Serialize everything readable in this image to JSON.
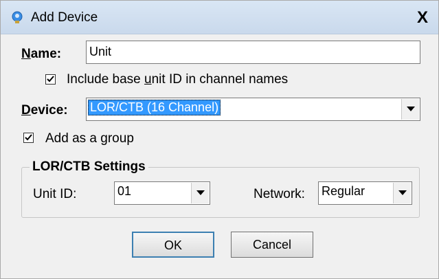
{
  "window": {
    "title": "Add Device",
    "close_glyph": "X"
  },
  "name_field": {
    "label_u": "N",
    "label_rest": "ame:",
    "value": "Unit"
  },
  "include_id_checkbox": {
    "checked": true,
    "label_a": "Include base ",
    "label_u": "u",
    "label_b": "nit ID in channel names"
  },
  "device_field": {
    "label_u": "D",
    "label_rest": "evice:",
    "selected": "LOR/CTB (16 Channel)"
  },
  "group_checkbox": {
    "checked": true,
    "label_a": "Add as a ",
    "label_u": "g",
    "label_b": "roup"
  },
  "settings": {
    "title": "LOR/CTB Settings",
    "unit_id_label": "Unit ID:",
    "unit_id_value": "01",
    "network_label": "Network:",
    "network_value": "Regular"
  },
  "buttons": {
    "ok": "OK",
    "cancel": "Cancel"
  },
  "colors": {
    "selection": "#3399ff",
    "titlebar": "#d9e6f4"
  },
  "icons": {
    "title": "lightbulb-icon",
    "dropdown": "chevron-down-icon",
    "close": "close-icon"
  }
}
